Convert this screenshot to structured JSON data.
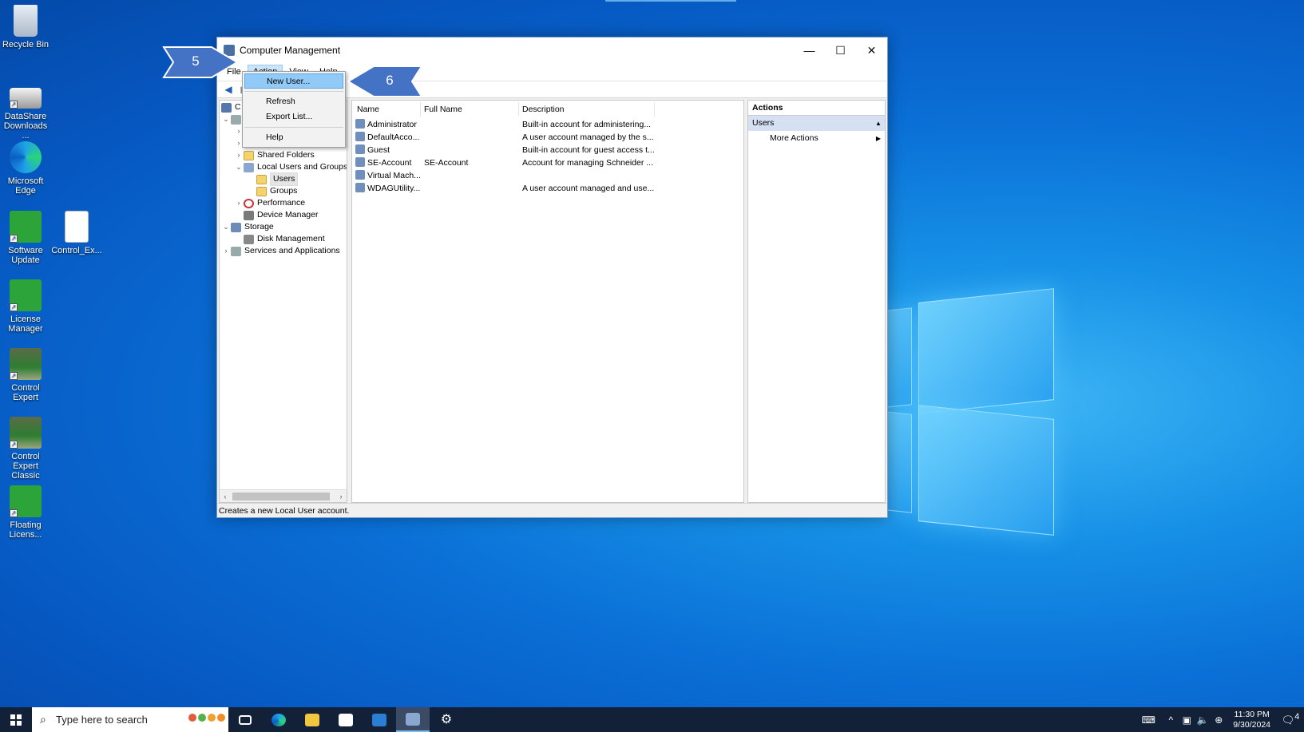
{
  "desktop": {
    "icons": [
      {
        "label": "Recycle Bin"
      },
      {
        "label": "DataShare Downloads ..."
      },
      {
        "label": "Microsoft Edge"
      },
      {
        "label": "Software Update"
      },
      {
        "label": "Control_Ex..."
      },
      {
        "label": "License Manager"
      },
      {
        "label": "Control Expert"
      },
      {
        "label": "Control Expert Classic"
      },
      {
        "label": "Floating Licens..."
      }
    ]
  },
  "window": {
    "title": "Computer Management",
    "controls": {
      "minimize": "—",
      "maximize": "☐",
      "close": "✕"
    },
    "menus": [
      "File",
      "Action",
      "View",
      "Help"
    ],
    "tree": {
      "root_fragment": "C",
      "shared_folders": "Shared Folders",
      "local_users_groups": "Local Users and Groups",
      "users": "Users",
      "groups": "Groups",
      "performance": "Performance",
      "device_manager": "Device Manager",
      "storage": "Storage",
      "disk_management": "Disk Management",
      "services_apps": "Services and Applications"
    },
    "columns": [
      "Name",
      "Full Name",
      "Description"
    ],
    "rows": [
      {
        "name": "Administrator",
        "full_name": "",
        "description": "Built-in account for administering..."
      },
      {
        "name": "DefaultAcco...",
        "full_name": "",
        "description": "A user account managed by the s..."
      },
      {
        "name": "Guest",
        "full_name": "",
        "description": "Built-in account for guest access t..."
      },
      {
        "name": "SE-Account",
        "full_name": "SE-Account",
        "description": "Account for managing Schneider ..."
      },
      {
        "name": "Virtual Mach...",
        "full_name": "",
        "description": ""
      },
      {
        "name": "WDAGUtility...",
        "full_name": "",
        "description": "A user account managed and use..."
      }
    ],
    "actions": {
      "title": "Actions",
      "section": "Users",
      "item": "More Actions"
    },
    "status": "Creates a new Local User account."
  },
  "action_menu": {
    "items": [
      "New User...",
      "Refresh",
      "Export List...",
      "Help"
    ]
  },
  "callouts": {
    "step5": "5",
    "step6": "6"
  },
  "taskbar": {
    "search_placeholder": "Type here to search",
    "time": "11:30 PM",
    "date": "9/30/2024",
    "notification_count": "4"
  }
}
